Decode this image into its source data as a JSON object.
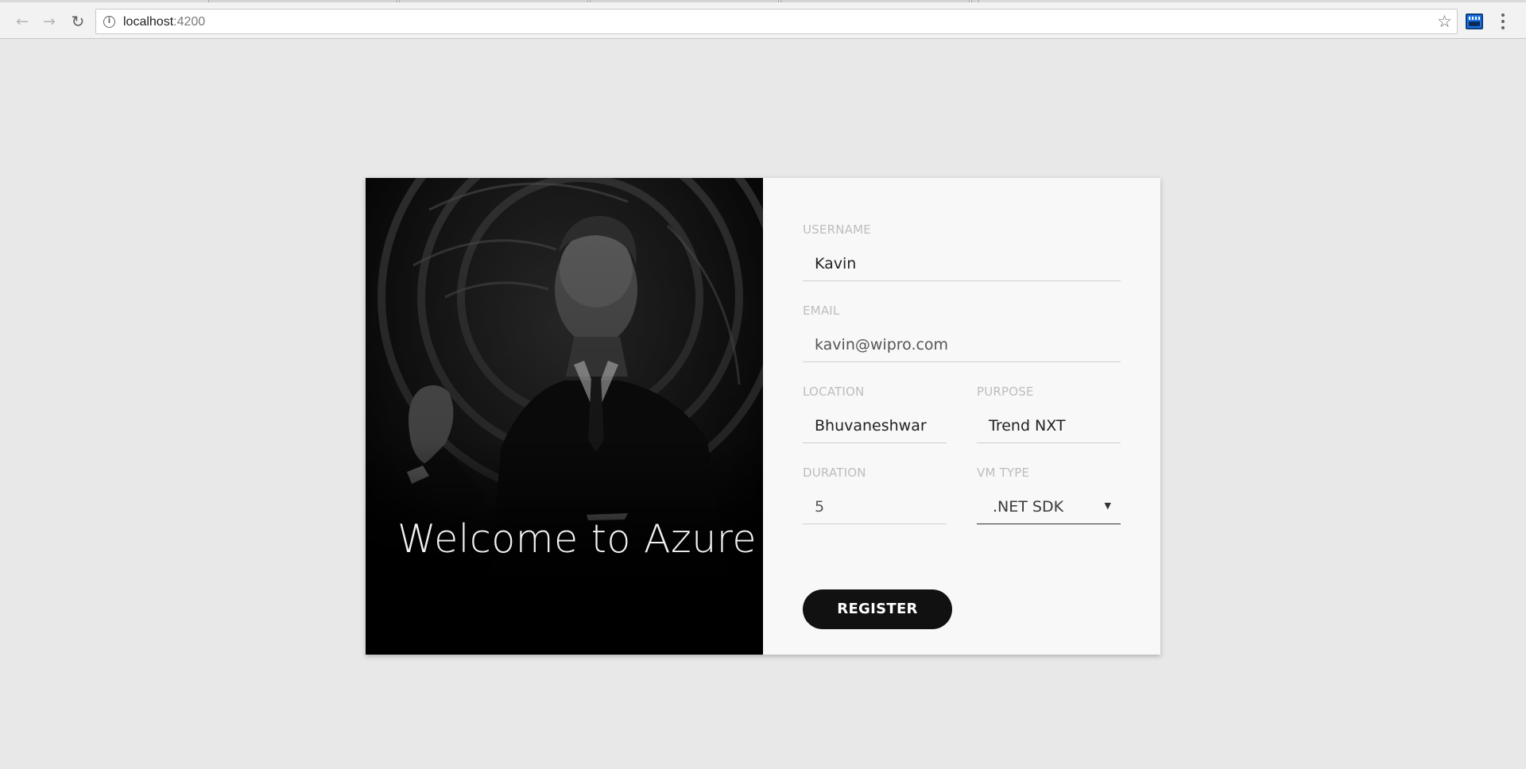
{
  "browser": {
    "url_host": "localhost",
    "url_port": ":4200",
    "back_icon": "back-arrow-icon",
    "forward_icon": "forward-arrow-icon",
    "reload_icon": "reload-icon",
    "info_icon": "info-icon",
    "bookmark_icon": "star-icon",
    "extension_icon": "extension-icon",
    "menu_icon": "kebab-menu-icon"
  },
  "hero": {
    "title": "Welcome to Azure"
  },
  "form": {
    "username": {
      "label": "USERNAME",
      "value": "Kavin"
    },
    "email": {
      "label": "EMAIL",
      "value": "kavin@wipro.com"
    },
    "location": {
      "label": "LOCATION",
      "value": "Bhuvaneshwar"
    },
    "purpose": {
      "label": "PURPOSE",
      "value": "Trend NXT"
    },
    "duration": {
      "label": "DURATION",
      "value": "5"
    },
    "vm_type": {
      "label": "VM TYPE",
      "value": ".NET SDK"
    },
    "register_label": "REGISTER"
  },
  "colors": {
    "page_background": "#e8e8e8",
    "card_background": "#f8f8f8",
    "hero_background": "#000000",
    "button_background": "#111111",
    "label_color": "#bdbdbd"
  }
}
